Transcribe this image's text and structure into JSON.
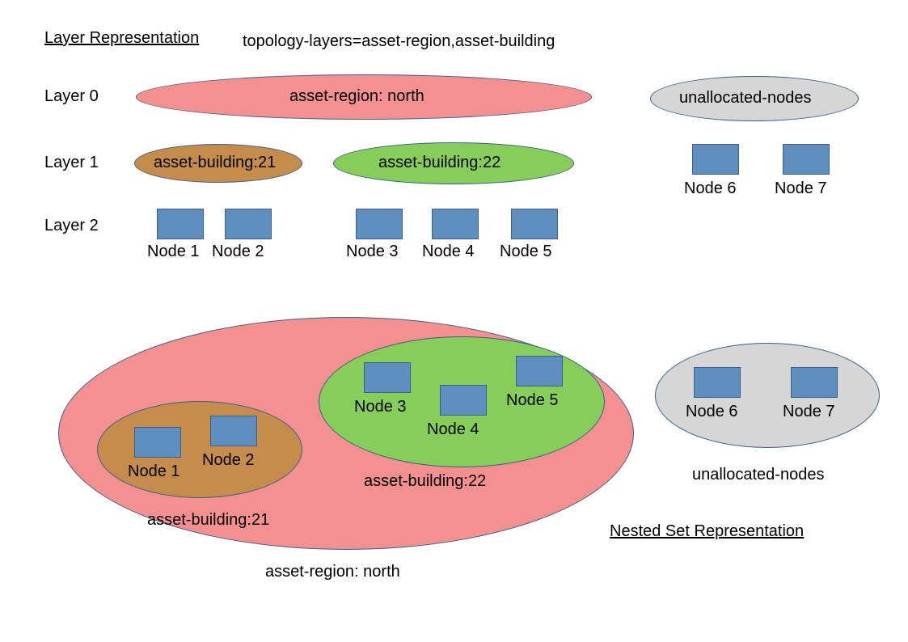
{
  "titles": {
    "layer_rep": "Layer Representation",
    "nested_rep": "Nested Set Representation",
    "topology": "topology-layers=asset-region,asset-building"
  },
  "layer_labels": {
    "l0": "Layer 0",
    "l1": "Layer 1",
    "l2": "Layer 2"
  },
  "ellipses": {
    "region_north": "asset-region: north",
    "building21": "asset-building:21",
    "building22": "asset-building:22",
    "unallocated": "unallocated-nodes"
  },
  "nodes": {
    "n1": "Node 1",
    "n2": "Node 2",
    "n3": "Node 3",
    "n4": "Node 4",
    "n5": "Node 5",
    "n6": "Node 6",
    "n7": "Node 7"
  },
  "chart_data": {
    "type": "diagram",
    "topology_layers": [
      "asset-region",
      "asset-building"
    ],
    "layer_representation": {
      "layers": [
        {
          "index": 0,
          "items": [
            {
              "id": "asset-region:north",
              "color": "pink"
            }
          ]
        },
        {
          "index": 1,
          "items": [
            {
              "id": "asset-building:21",
              "color": "brown"
            },
            {
              "id": "asset-building:22",
              "color": "green"
            }
          ]
        },
        {
          "index": 2,
          "items": [
            {
              "id": "Node 1",
              "parent": "asset-building:21"
            },
            {
              "id": "Node 2",
              "parent": "asset-building:21"
            },
            {
              "id": "Node 3",
              "parent": "asset-building:22"
            },
            {
              "id": "Node 4",
              "parent": "asset-building:22"
            },
            {
              "id": "Node 5",
              "parent": "asset-building:22"
            }
          ]
        }
      ],
      "unallocated": [
        "Node 6",
        "Node 7"
      ]
    },
    "nested_set_representation": {
      "root": {
        "id": "asset-region:north",
        "children": [
          {
            "id": "asset-building:21",
            "nodes": [
              "Node 1",
              "Node 2"
            ]
          },
          {
            "id": "asset-building:22",
            "nodes": [
              "Node 3",
              "Node 4",
              "Node 5"
            ]
          }
        ]
      },
      "unallocated": [
        "Node 6",
        "Node 7"
      ]
    }
  }
}
